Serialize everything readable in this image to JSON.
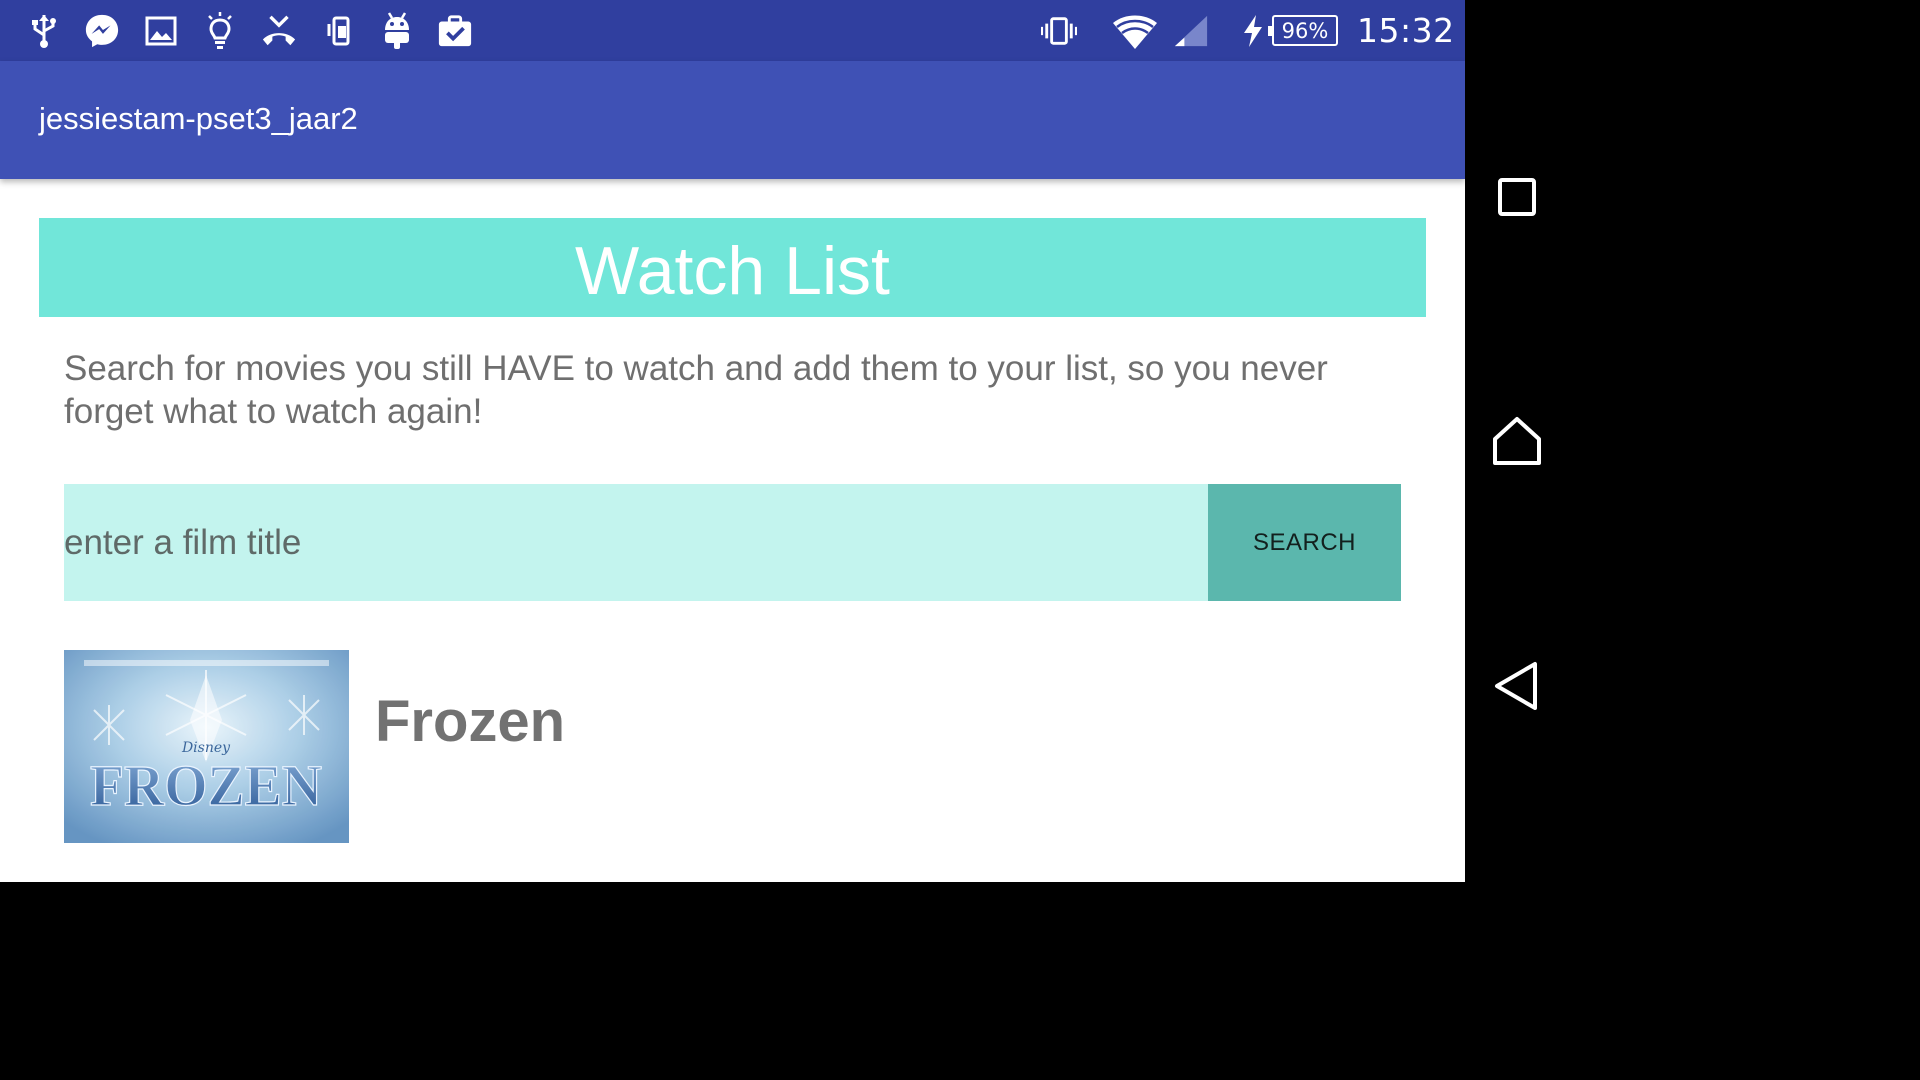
{
  "status_bar": {
    "battery_level": "96%",
    "time": "15:32",
    "icons_left": [
      "usb-icon",
      "messenger-icon",
      "image-icon",
      "lightbulb-icon",
      "missed-call-icon",
      "phone-sync-icon",
      "android-icon",
      "clipboard-check-icon"
    ],
    "icons_right": [
      "vibrate-icon",
      "wifi-icon",
      "signal-icon",
      "charging-icon"
    ]
  },
  "app_bar": {
    "title": "jessiestam-pset3_jaar2"
  },
  "banner": {
    "title": "Watch List"
  },
  "intro": {
    "text": "Search for movies you still HAVE to watch and add them to your list, so you never forget what to watch again!"
  },
  "search": {
    "placeholder": "enter a film title",
    "value": "",
    "button_label": "SEARCH"
  },
  "results": [
    {
      "title": "Frozen",
      "poster_text": "FROZEN",
      "poster_small_text": "Disney"
    }
  ],
  "nav_bar": {
    "items": [
      "recents-icon",
      "home-icon",
      "back-icon"
    ]
  },
  "colors": {
    "status_bar": "#303f9f",
    "app_bar": "#3f51b5",
    "banner": "#71e6d9",
    "search_field": "#c3f4ee",
    "search_button": "#5bb7ad"
  }
}
